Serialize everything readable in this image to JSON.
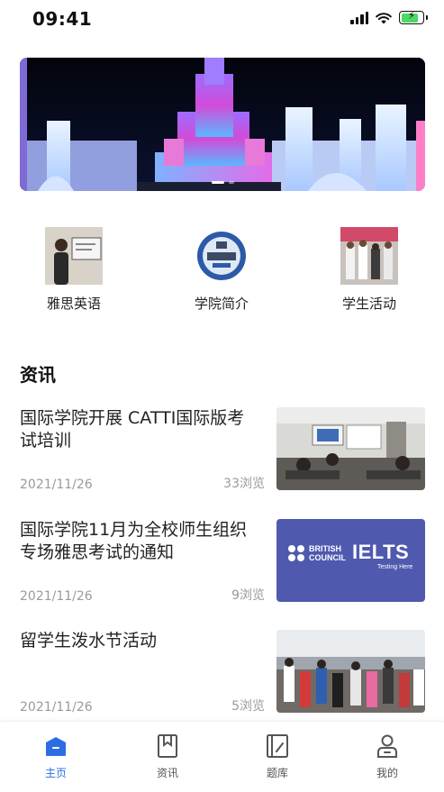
{
  "status_bar": {
    "time": "09:41",
    "battery_level": 0.7
  },
  "quick_entries": [
    {
      "label": "雅思英语",
      "icon": "ielts-teacher-thumb"
    },
    {
      "label": "学院简介",
      "icon": "college-emblem-thumb"
    },
    {
      "label": "学生活动",
      "icon": "student-activity-thumb"
    }
  ],
  "news_section": {
    "title": "资讯"
  },
  "news": [
    {
      "title": "国际学院开展 CATTI国际版考试培训",
      "date": "2021/11/26",
      "views": "33浏览"
    },
    {
      "title": "国际学院11月为全校师生组织专场雅思考试的通知",
      "date": "2021/11/26",
      "views": "9浏览"
    },
    {
      "title": "留学生泼水节活动",
      "date": "2021/11/26",
      "views": "5浏览"
    }
  ],
  "ielts_image": {
    "brand_1": "BRITISH",
    "brand_2": "COUNCIL",
    "logo": "IELTS",
    "tagline": "Testing Here"
  },
  "tabs": [
    {
      "label": "主页",
      "icon": "home-icon",
      "active": true
    },
    {
      "label": "资讯",
      "icon": "bookmark-icon",
      "active": false
    },
    {
      "label": "题库",
      "icon": "question-bank-icon",
      "active": false
    },
    {
      "label": "我的",
      "icon": "profile-icon",
      "active": false
    }
  ],
  "colors": {
    "accent": "#2d6de3",
    "muted": "#9a9a9a"
  }
}
